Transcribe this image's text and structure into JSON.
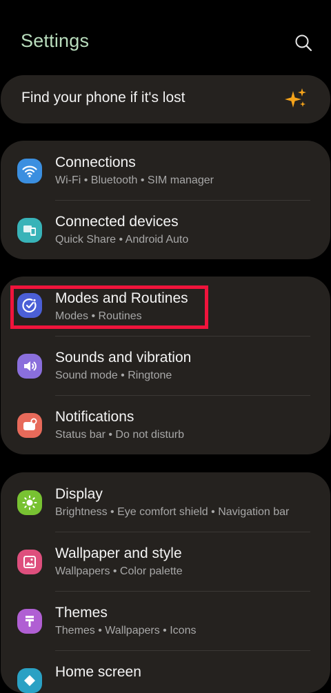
{
  "header": {
    "title": "Settings",
    "search_icon": "search-icon"
  },
  "find_phone": {
    "label": "Find your phone if it's lost",
    "icon": "sparkle-icon",
    "icon_color": "#f5a31a"
  },
  "groups": [
    {
      "items": [
        {
          "title": "Connections",
          "subtitle": "Wi-Fi  •  Bluetooth  •  SIM manager",
          "icon": "wifi-icon",
          "color": "#3b8fe0"
        },
        {
          "title": "Connected devices",
          "subtitle": "Quick Share  •  Android Auto",
          "icon": "connected-devices-icon",
          "color": "#38b3b8"
        }
      ]
    },
    {
      "items": [
        {
          "title": "Modes and Routines",
          "subtitle": "Modes  •  Routines",
          "icon": "modes-routines-icon",
          "color": "#4b5fd6"
        },
        {
          "title": "Sounds and vibration",
          "subtitle": "Sound mode  •  Ringtone",
          "icon": "speaker-icon",
          "color": "#8a6fdc"
        },
        {
          "title": "Notifications",
          "subtitle": "Status bar  •  Do not disturb",
          "icon": "notification-icon",
          "color": "#e76a5a"
        }
      ]
    },
    {
      "items": [
        {
          "title": "Display",
          "subtitle": "Brightness  •  Eye comfort shield  •  Navigation bar",
          "icon": "sun-icon",
          "color": "#78c232"
        },
        {
          "title": "Wallpaper and style",
          "subtitle": "Wallpapers  •  Color palette",
          "icon": "wallpaper-icon",
          "color": "#de4f7d"
        },
        {
          "title": "Themes",
          "subtitle": "Themes  •  Wallpapers  •  Icons",
          "icon": "themes-icon",
          "color": "#b05fd3"
        },
        {
          "title": "Home screen",
          "subtitle": "",
          "icon": "home-screen-icon",
          "color": "#2aa1c4"
        }
      ]
    }
  ],
  "colors": {
    "highlight": "#f0143c",
    "card": "#25221f",
    "title": "#b9ddbd"
  }
}
